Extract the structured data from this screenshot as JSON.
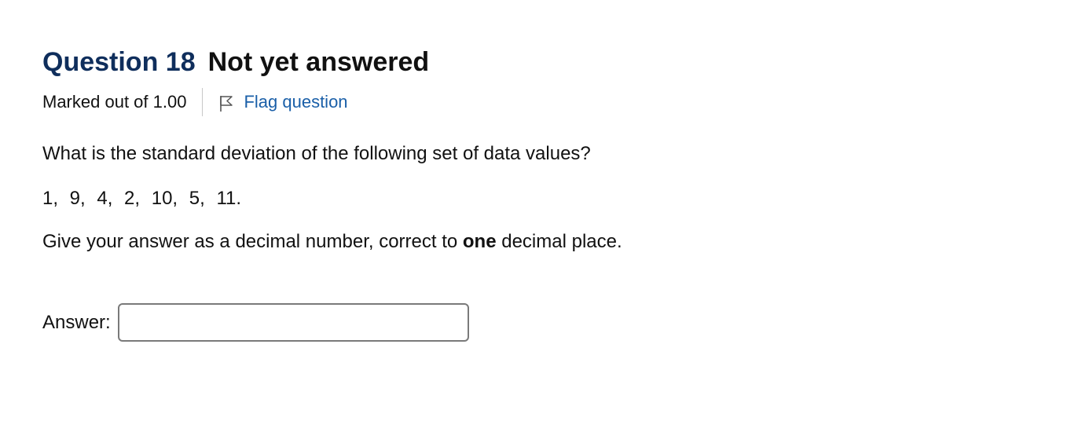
{
  "question": {
    "label": "Question 18",
    "state": "Not yet answered",
    "grade": "Marked out of 1.00",
    "flag_label": "Flag question",
    "flag_icon": "flag-outline-icon"
  },
  "question_text": {
    "line1": "What is the standard deviation of the following set of data values?",
    "data_values": "1,  9,  4,  2,  10,  5,  11.",
    "instruction_prefix": "Give your answer as a decimal number, correct to ",
    "instruction_bold": "one",
    "instruction_suffix": " decimal place."
  },
  "answer": {
    "label": "Answer:",
    "value": ""
  },
  "colors": {
    "question_label": "#0f2e5c",
    "link": "#1a5fa8",
    "text": "#111111",
    "input_border": "#7a7a7a"
  }
}
